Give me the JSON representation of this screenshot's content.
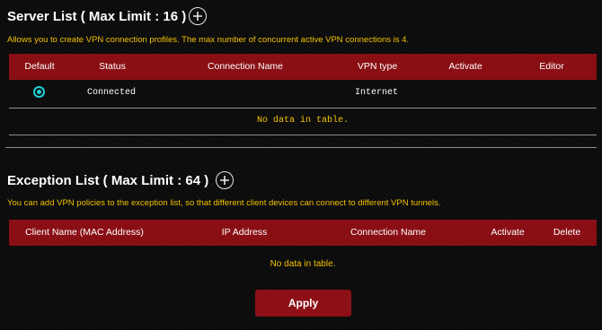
{
  "server_list": {
    "title": "Server List ( Max Limit : 16 )",
    "description": "Allows you to create VPN connection profiles. The max number of concurrent active VPN connections is 4.",
    "columns": [
      "Default",
      "Status",
      "Connection Name",
      "VPN type",
      "Activate",
      "Editor"
    ],
    "rows": [
      {
        "default": "selected",
        "status": "Connected",
        "connection_name": "",
        "vpn_type": "Internet",
        "activate": "",
        "editor": ""
      }
    ],
    "empty_message": "No data in table."
  },
  "exception_list": {
    "title": "Exception List ( Max Limit : 64 )",
    "description": "You can add VPN policies to the exception list, so that different client devices can connect to different VPN tunnels.",
    "columns": [
      "Client Name (MAC Address)",
      "IP Address",
      "Connection Name",
      "Activate",
      "Delete"
    ],
    "empty_message": "No data in table."
  },
  "apply_label": "Apply",
  "icons": {
    "add": "plus-circle-icon",
    "default_radio": "radio-selected-icon"
  },
  "colors": {
    "header": "#8a0f14",
    "accent_text": "#f2c200",
    "radio": "#1fd0d6",
    "button": "#8d1016"
  }
}
